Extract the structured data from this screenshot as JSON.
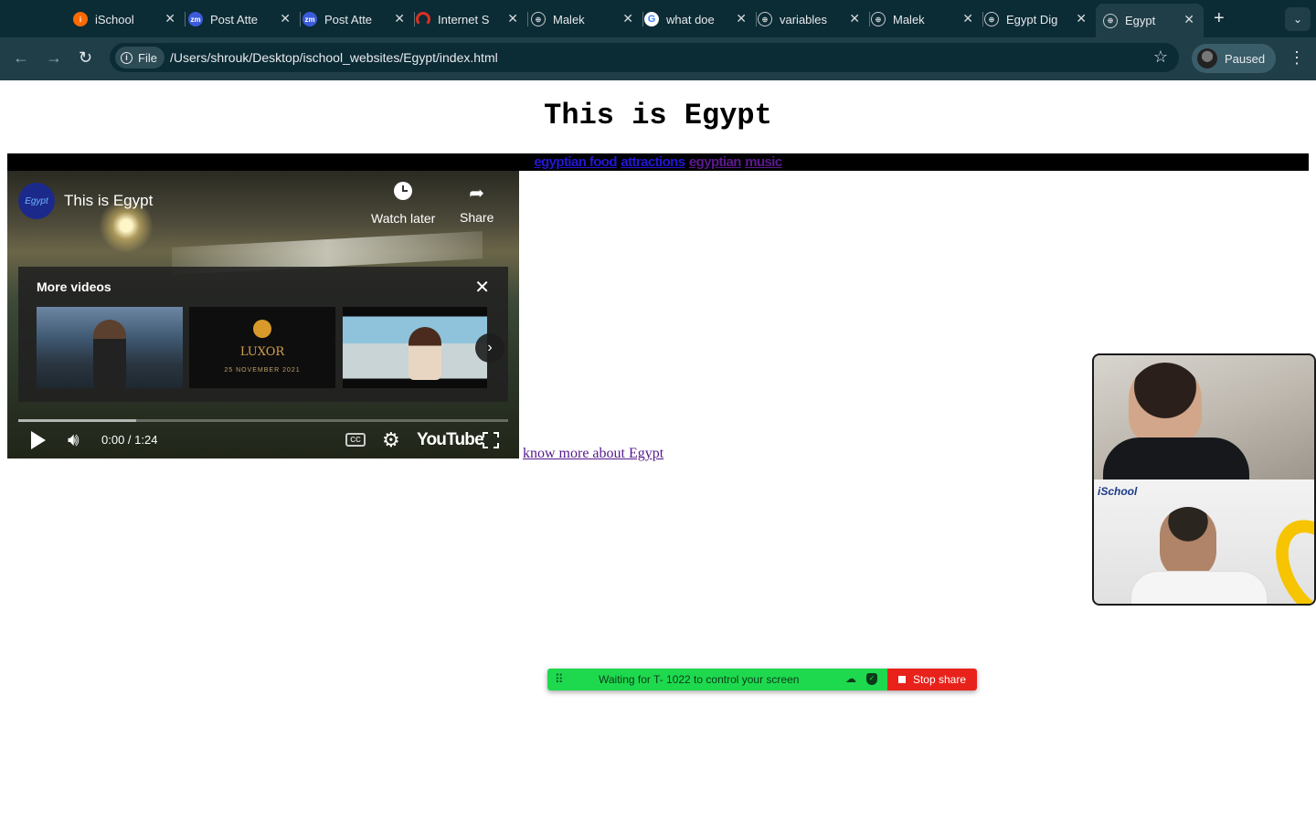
{
  "browser": {
    "tabs": [
      {
        "title": "iSchool",
        "icon": "ischool-icon",
        "color": "#ff6a00"
      },
      {
        "title": "Post Atte",
        "icon": "zoom-icon",
        "color": "#3b5bdb"
      },
      {
        "title": "Post Atte",
        "icon": "zoom-icon",
        "color": "#3b5bdb"
      },
      {
        "title": "Internet S",
        "icon": "speedometer-icon",
        "color": "#d93025"
      },
      {
        "title": "Malek",
        "icon": "globe-icon",
        "color": "#9aa0a6"
      },
      {
        "title": "what doe",
        "icon": "google-icon",
        "color": "#ffffff"
      },
      {
        "title": "variables",
        "icon": "globe-icon",
        "color": "#9aa0a6"
      },
      {
        "title": "Malek",
        "icon": "globe-icon",
        "color": "#9aa0a6"
      },
      {
        "title": "Egypt Dig",
        "icon": "globe-icon",
        "color": "#9aa0a6"
      },
      {
        "title": "Egypt",
        "icon": "globe-icon",
        "color": "#9aa0a6",
        "active": true
      }
    ],
    "new_tab": "+",
    "file_chip": "File",
    "url": "/Users/shrouk/Desktop/ischool_websites/Egypt/index.html",
    "profile_label": "Paused"
  },
  "page": {
    "title": "This is Egypt",
    "nav_links": [
      {
        "text": "egyptian food",
        "visited": false
      },
      {
        "text": "attractions",
        "visited": false
      },
      {
        "text": "egyptian",
        "visited": true
      },
      {
        "text": "music",
        "visited": true
      }
    ],
    "know_more_link": "know more about Egypt"
  },
  "video": {
    "title": "This is Egypt",
    "channel_logo_text": "Egypt",
    "watch_later": "Watch later",
    "share": "Share",
    "more_videos": "More videos",
    "thumb2_title": "LUXOR",
    "thumb2_date": "25 NOVEMBER 2021",
    "time": "0:00 / 1:24",
    "cc_label": "CC",
    "youtube_label": "YouTube",
    "buffered_fraction": 0.24
  },
  "zoom": {
    "ischool_logo": "iSchool",
    "share_status": "Waiting for T- 1022 to control your screen",
    "stop_share": "Stop share"
  },
  "colors": {
    "chrome_dark": "#0b2b35",
    "chrome_toolbar": "#1f3e48",
    "link_blue": "#2317d6",
    "link_visited": "#5b1a8e",
    "share_green": "#1ed94e",
    "stop_red": "#e8221b"
  }
}
